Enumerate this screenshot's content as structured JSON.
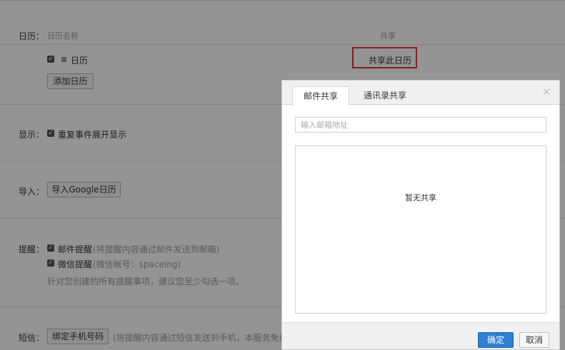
{
  "calendar_section": {
    "label": "日历：",
    "name_header": "日历名称",
    "share_header": "共享",
    "calendar_name": "日历",
    "share_link": "共享此日历",
    "add_button": "添加日历"
  },
  "display_section": {
    "label": "显示：",
    "option": "重复事件展开显示"
  },
  "import_section": {
    "label": "导入：",
    "button": "导入Google日历"
  },
  "reminder_section": {
    "label": "提醒：",
    "email_option": "邮件提醒",
    "email_note": "(将提醒内容通过邮件发送到邮箱)",
    "wechat_option": "微信提醒",
    "wechat_note": "(微信帐号：spaceing)",
    "hint": "针对您创建的所有提醒事项，建议您至少勾选一项。"
  },
  "sms_section": {
    "label": "短信：",
    "button": "绑定手机号码",
    "note": "(将提醒内容通过短信发送到手机，本服务免费。详"
  },
  "dialog": {
    "tabs": [
      "邮件共享",
      "通讯录共享"
    ],
    "close_glyph": "×",
    "email_placeholder": "输入邮箱地址",
    "empty_text": "暂无共享",
    "ok": "确定",
    "cancel": "取消"
  },
  "colors": {
    "highlight": "#e53232",
    "primary_button": "#2f7fd4"
  }
}
